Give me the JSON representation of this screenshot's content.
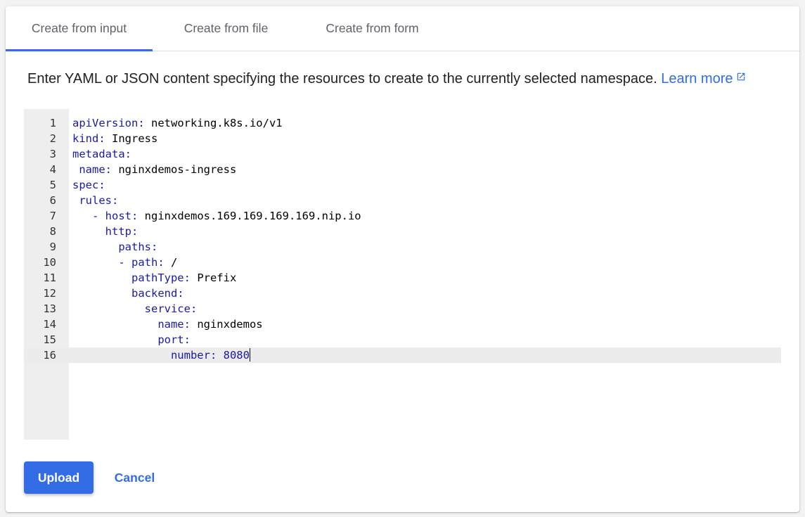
{
  "tabs": [
    {
      "label": "Create from input",
      "active": true
    },
    {
      "label": "Create from file",
      "active": false
    },
    {
      "label": "Create from form",
      "active": false
    }
  ],
  "intro": {
    "text": "Enter YAML or JSON content specifying the resources to create to the currently selected namespace.",
    "link_label": "Learn more",
    "link_icon": "open-in-new-icon"
  },
  "editor": {
    "current_line": 16,
    "lines": [
      {
        "num": "1",
        "key": "apiVersion:",
        "value": " networking.k8s.io/v1"
      },
      {
        "num": "2",
        "key": "kind:",
        "value": " Ingress"
      },
      {
        "num": "3",
        "key": "metadata:",
        "value": ""
      },
      {
        "num": "4",
        "key": " name:",
        "value": " nginxdemos-ingress"
      },
      {
        "num": "5",
        "key": "spec:",
        "value": ""
      },
      {
        "num": "6",
        "key": " rules:",
        "value": ""
      },
      {
        "num": "7",
        "key": "   - host:",
        "value": " nginxdemos.169.169.169.169.nip.io"
      },
      {
        "num": "8",
        "key": "     http:",
        "value": ""
      },
      {
        "num": "9",
        "key": "       paths:",
        "value": ""
      },
      {
        "num": "10",
        "key": "       - path:",
        "value": " /"
      },
      {
        "num": "11",
        "key": "         pathType:",
        "value": " Prefix"
      },
      {
        "num": "12",
        "key": "         backend:",
        "value": ""
      },
      {
        "num": "13",
        "key": "           service:",
        "value": ""
      },
      {
        "num": "14",
        "key": "             name:",
        "value": " nginxdemos"
      },
      {
        "num": "15",
        "key": "             port:",
        "value": ""
      },
      {
        "num": "16",
        "key": "               number:",
        "value": " 8080"
      }
    ]
  },
  "actions": {
    "upload_label": "Upload",
    "cancel_label": "Cancel"
  },
  "colors": {
    "accent": "#326de6",
    "yaml_key": "#1a1aa6",
    "gutter": "#eeeeee"
  }
}
